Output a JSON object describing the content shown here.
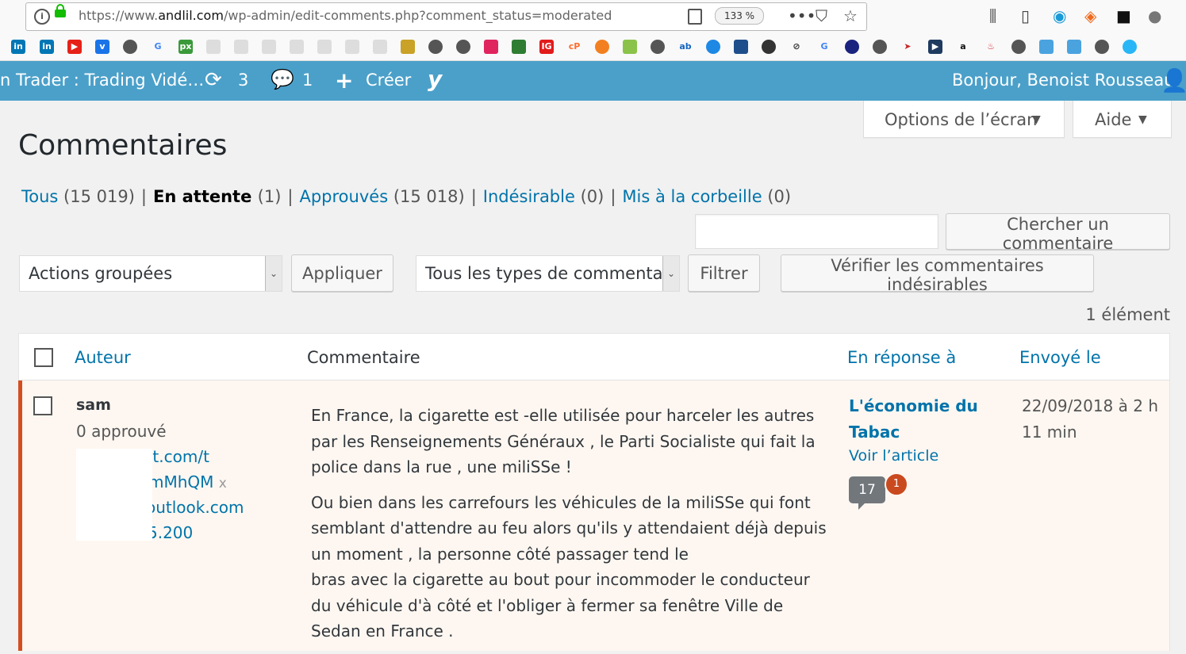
{
  "browser": {
    "url_prefix": "https://www.",
    "url_domain": "andlil.com",
    "url_path": "/wp-admin/edit-comments.php?comment_status=moderated",
    "zoom": "133 %"
  },
  "admin_bar": {
    "site_name": "n Trader : Trading Vidé…",
    "updates_count": "3",
    "comments_count": "1",
    "create_label": "Créer",
    "greeting": "Bonjour, Benoist Rousseau"
  },
  "screen_options": {
    "options_label": "Options de l’écran",
    "help_label": "Aide"
  },
  "page_title": "Commentaires",
  "filters": {
    "all_label": "Tous",
    "all_count": "(15 019)",
    "pending_label": "En attente",
    "pending_count": "(1)",
    "approved_label": "Approuvés",
    "approved_count": "(15 018)",
    "spam_label": "Indésirable",
    "spam_count": "(0)",
    "trash_label": "Mis à la corbeille",
    "trash_count": "(0)",
    "separator": "|"
  },
  "search": {
    "button_label": "Chercher un commentaire",
    "value": ""
  },
  "toolbar": {
    "bulk_actions": "Actions groupées",
    "apply_label": "Appliquer",
    "type_filter": "Tous les types de commentai",
    "filter_label": "Filtrer",
    "check_spam_label": "Vérifier les commentaires indésirables",
    "item_count": "1 élément"
  },
  "table": {
    "headers": {
      "author": "Auteur",
      "comment": "Commentaire",
      "response": "En réponse à",
      "date": "Envoyé le"
    },
    "row": {
      "author_name": "sam",
      "author_approved": "0 approuvé",
      "author_url_fragment": "st.com/t",
      "author_email_fragment": "mMhQM",
      "author_email_remove": "x",
      "author_mail_fragment": "outlook.com",
      "author_ip_fragment": "5.200",
      "comment_p1": "En France, la cigarette est -elle utilisée pour harceler les autres par les Renseignements Généraux , le Parti Socialiste qui fait la police dans la rue , une miliSSe !",
      "comment_p2a": "Ou bien dans les carrefours les véhicules de la miliSSe qui font semblant d'attendre au feu alors qu'ils y attendaient déjà depuis un moment , la personne côté passager tend le",
      "comment_p2b": "bras avec la cigarette au bout pour incommoder le conducteur du véhicule d'à côté et l'obliger à fermer sa fenêtre Ville de Sedan en France .",
      "response_title": "L'économie du Tabac",
      "response_link": "Voir l’article",
      "approved_comments": "17",
      "pending_comments": "1",
      "date": "22/09/2018 à 2 h 11 min"
    }
  }
}
